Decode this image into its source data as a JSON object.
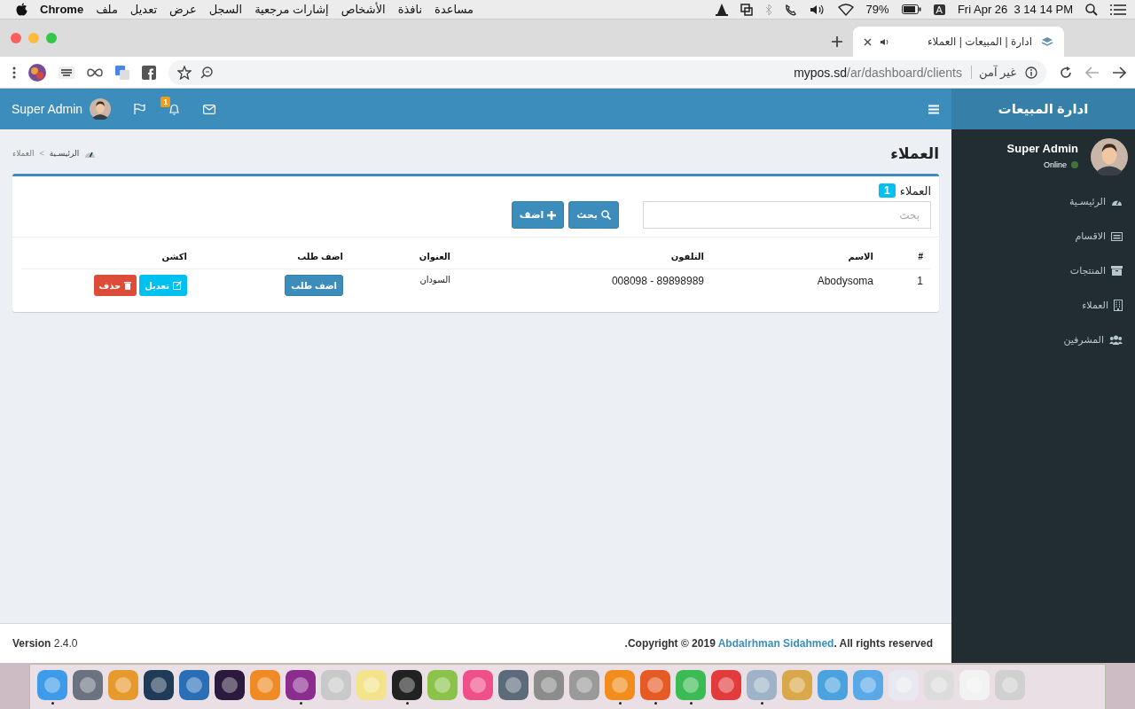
{
  "menubar": {
    "app": "Chrome",
    "menus": [
      "مساعدة",
      "نافذة",
      "الأشخاص",
      "إشارات مرجعية",
      "السجل",
      "عرض",
      "تعديل",
      "ملف"
    ],
    "battery": "79%",
    "input_source": "A",
    "clock": "Fri Apr 26  3 14 14 PM"
  },
  "browser": {
    "tab_title": "ادارة | المبيعات | العملاء",
    "url_host": "mypos.sd",
    "url_path": "/ar/dashboard/clients",
    "security": "غير آمن"
  },
  "app": {
    "brand": "ادارة المبيعات",
    "topbar_user": "Super Admin",
    "notification_count": "1",
    "sidebar": {
      "user": "Super Admin",
      "status": "Online",
      "items": [
        {
          "label": "الرئيسـية",
          "kind": "dashboard"
        },
        {
          "label": "الاقسام",
          "kind": "keyboard"
        },
        {
          "label": "المنتجات",
          "kind": "archive"
        },
        {
          "label": "العملاء",
          "kind": "building"
        },
        {
          "label": "المشرفين",
          "kind": "users"
        }
      ]
    },
    "page_title": "العملاء",
    "breadcrumb": {
      "home": "الرئيسـية",
      "separator": ">",
      "current": "العملاء"
    },
    "box": {
      "title": "العملاء",
      "count": "1",
      "search": {
        "placeholder": "بحث"
      },
      "search_button": "بحث",
      "add_button": "اضف",
      "table": {
        "columns": [
          "#",
          "الاسم",
          "التلفون",
          "العنوان",
          "اضف طلب",
          "اكشن"
        ],
        "rows": [
          {
            "index": "1",
            "name": "Abodysoma",
            "phone": "008098 - 89898989",
            "address": "السودان",
            "order_button": "اضف طلب",
            "edit_button": "تعديل",
            "delete_button": "حذف"
          }
        ]
      }
    },
    "footer": {
      "version_label": "Version",
      "version": "2.4.0",
      "copyright_prefix": ".Copyright © 2019",
      "copyright_link": "Abdalrhman Sidahmed",
      "copyright_suffix": ". All rights reserved"
    }
  },
  "dock": [
    {
      "color": "#3d9be9",
      "running": true
    },
    {
      "color": "#6b7380",
      "running": false
    },
    {
      "color": "#e69a2e",
      "running": false
    },
    {
      "color": "#1f3b57",
      "running": false
    },
    {
      "color": "#2a6fb5",
      "running": false
    },
    {
      "color": "#2b1a3d",
      "running": false
    },
    {
      "color": "#f08a24",
      "running": false
    },
    {
      "color": "#8a2d8f",
      "running": true
    },
    {
      "color": "#c9c9c9",
      "running": false
    },
    {
      "color": "#f3e38a",
      "running": false
    },
    {
      "color": "#222222",
      "running": true
    },
    {
      "color": "#8bc34a",
      "running": false
    },
    {
      "color": "#f0508a",
      "running": false
    },
    {
      "color": "#5c6b7a",
      "running": false
    },
    {
      "color": "#8c8c8c",
      "running": false
    },
    {
      "color": "#9a9a9a",
      "running": false
    },
    {
      "color": "#f28c1c",
      "running": true
    },
    {
      "color": "#e65a24",
      "running": true
    },
    {
      "color": "#3cba54",
      "running": true
    },
    {
      "color": "#e23b3b",
      "running": false
    },
    {
      "color": "#9fb3c8",
      "running": true
    },
    {
      "color": "#d9a84a",
      "running": false
    },
    {
      "color": "#4aa3df",
      "running": false
    },
    {
      "color": "#5aa9e6",
      "running": false
    },
    {
      "color": "#e8e8f0",
      "running": false
    },
    {
      "color": "#dcdcdc",
      "running": false
    },
    {
      "color": "#f2f2f2",
      "running": false
    },
    {
      "color": "#d0d0d0",
      "running": false
    }
  ]
}
